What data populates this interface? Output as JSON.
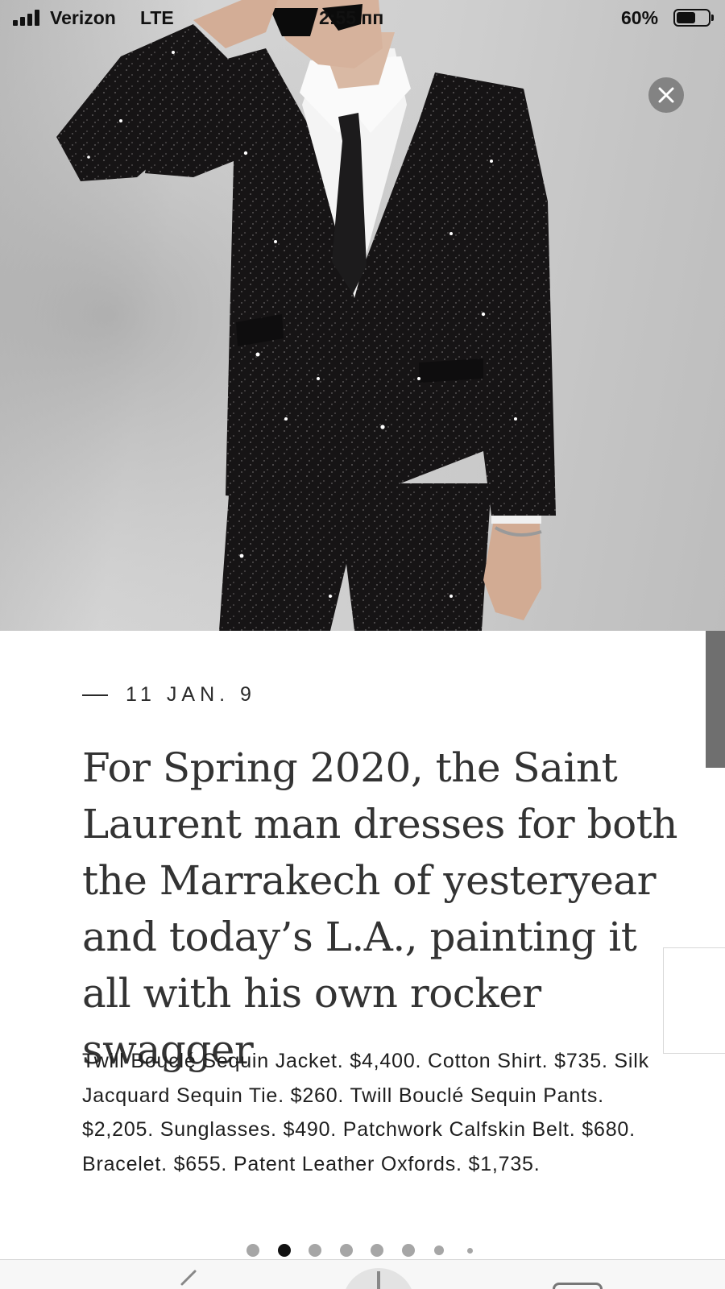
{
  "status_bar": {
    "carrier": "Verizon",
    "network": "LTE",
    "time": "2:55 пп",
    "battery_percent": "60%",
    "battery_level": 0.6
  },
  "photo": {
    "background_color": "#c8c8c8",
    "suit_color": "#141213"
  },
  "close_button": {
    "icon": "close-icon"
  },
  "article": {
    "date": "11 JAN. 9",
    "headline": "For Spring 2020, the Saint Laurent man dresses for both the Marrakech of yesteryear and today’s L.A., painting it all with his own rocker swagger",
    "caption": "Twill Bouclé Sequin Jacket. $4,400. Cotton Shirt. $735. Silk Jacquard Sequin Tie. $260. Twill Bouclé Sequin Pants. $2,205. Sunglasses. $490. Patchwork Calfskin Belt. $680. Bracelet. $655. Patent Leather Oxfords. $1,735."
  },
  "pagination": {
    "total": 8,
    "active_index": 1,
    "active_color": "#111111",
    "inactive_color": "#a6a6a6"
  },
  "toolbar": {
    "icons": [
      "back-icon",
      "share-icon",
      "tabs-icon"
    ]
  }
}
